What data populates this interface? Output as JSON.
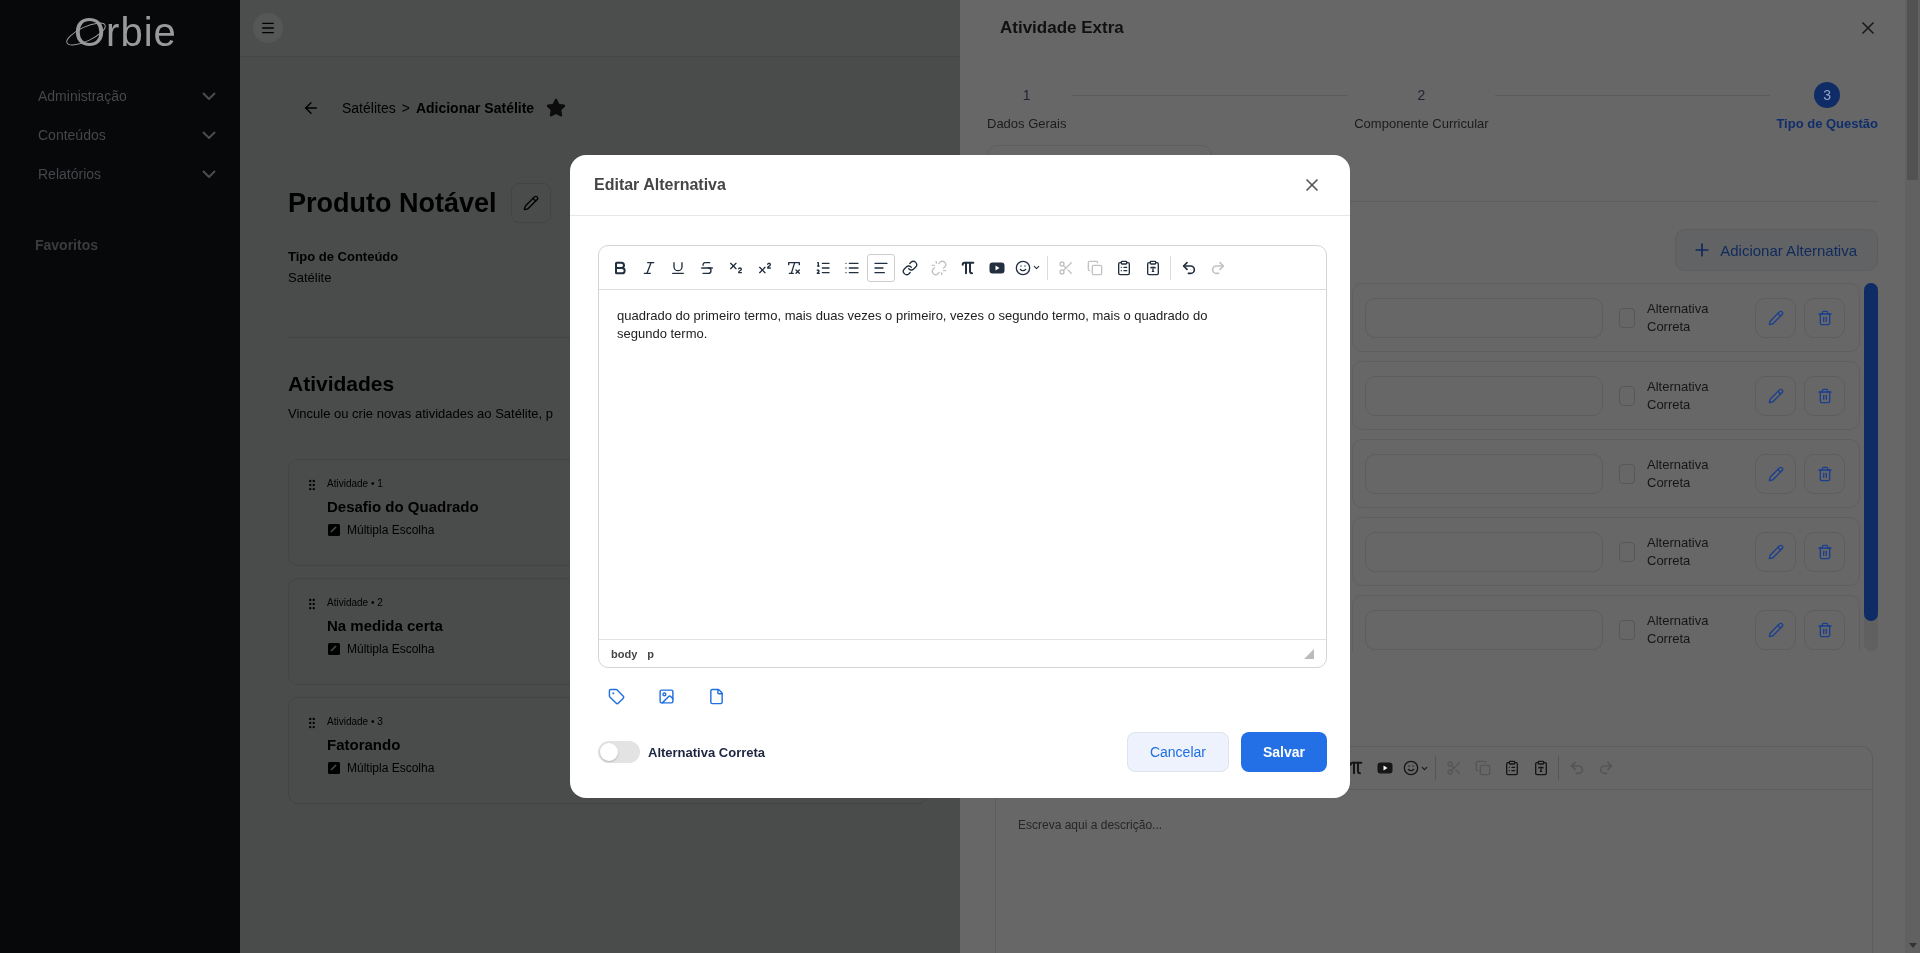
{
  "sidebar": {
    "logo": "Orbie",
    "items": [
      {
        "label": "Administração",
        "expanded": false
      },
      {
        "label": "Conteúdos",
        "expanded": false
      },
      {
        "label": "Relatórios",
        "expanded": false
      }
    ],
    "favorites_title": "Favoritos"
  },
  "main": {
    "breadcrumb": {
      "parent": "Satélites",
      "separator": ">",
      "current": "Adicionar Satélite",
      "favorite": true
    },
    "title": "Produto Notável",
    "content_type": {
      "label": "Tipo de Conteúdo",
      "value": "Satélite"
    },
    "activities": {
      "title": "Atividades",
      "subtitle": "Vincule ou crie novas atividades ao Satélite, p",
      "items": [
        {
          "label": "Atividade • 1",
          "title": "Desafio do Quadrado",
          "type": "Múltipla Escolha"
        },
        {
          "label": "Atividade • 2",
          "title": "Na medida certa",
          "type": "Múltipla Escolha"
        },
        {
          "label": "Atividade • 3",
          "title": "Fatorando",
          "type": "Múltipla Escolha"
        }
      ]
    }
  },
  "drawer": {
    "title": "Atividade Extra",
    "steps": [
      {
        "number": "1",
        "label": "Dados Gerais",
        "selected": false
      },
      {
        "number": "2",
        "label": "Componente Curricular",
        "selected": false
      },
      {
        "number": "3",
        "label": "Tipo de Questão",
        "selected": true
      }
    ],
    "add_button": "Adicionar Alternativa",
    "alternatives": [
      {
        "label": "Alternativa Correta",
        "checked": false
      },
      {
        "label": "Alternativa Correta",
        "checked": false
      },
      {
        "label": "Alternativa Correta",
        "checked": false
      },
      {
        "label": "Alternativa Correta",
        "checked": false
      },
      {
        "label": "Alternativa Correta",
        "checked": false
      }
    ],
    "description_editor": {
      "placeholder": "Escreva aqui a descrição...",
      "toolbar_groups": [
        [
          {
            "kind": "pi",
            "disabled": false,
            "selected": false
          },
          {
            "kind": "youtube",
            "disabled": false,
            "selected": false
          },
          {
            "kind": "emoji",
            "disabled": false,
            "selected": false
          }
        ],
        [
          {
            "kind": "cut",
            "disabled": true,
            "selected": false
          },
          {
            "kind": "copy",
            "disabled": true,
            "selected": false
          },
          {
            "kind": "paste",
            "disabled": false,
            "selected": false
          },
          {
            "kind": "paste_text",
            "disabled": false,
            "selected": false
          }
        ],
        [
          {
            "kind": "undo",
            "disabled": true,
            "selected": false
          },
          {
            "kind": "redo",
            "disabled": true,
            "selected": false
          }
        ]
      ]
    }
  },
  "modal": {
    "title": "Editar Alternativa",
    "toolbar_groups": [
      [
        {
          "kind": "bold",
          "disabled": false,
          "selected": false
        },
        {
          "kind": "italic",
          "disabled": false,
          "selected": false
        },
        {
          "kind": "underline",
          "disabled": false,
          "selected": false
        },
        {
          "kind": "strike",
          "disabled": false,
          "selected": false
        },
        {
          "kind": "subscript",
          "disabled": false,
          "selected": false
        },
        {
          "kind": "superscript",
          "disabled": false,
          "selected": false
        },
        {
          "kind": "clear_format",
          "disabled": false,
          "selected": false
        },
        {
          "kind": "ordered_list",
          "disabled": false,
          "selected": false
        },
        {
          "kind": "bullet_list",
          "disabled": false,
          "selected": false
        },
        {
          "kind": "align_left",
          "disabled": false,
          "selected": true
        },
        {
          "kind": "link",
          "disabled": false,
          "selected": false
        },
        {
          "kind": "unlink",
          "disabled": true,
          "selected": false
        },
        {
          "kind": "pi",
          "disabled": false,
          "selected": false
        },
        {
          "kind": "youtube",
          "disabled": false,
          "selected": false
        },
        {
          "kind": "emoji",
          "disabled": false,
          "selected": false
        }
      ],
      [
        {
          "kind": "cut",
          "disabled": true,
          "selected": false
        },
        {
          "kind": "copy",
          "disabled": true,
          "selected": false
        },
        {
          "kind": "paste",
          "disabled": false,
          "selected": false
        },
        {
          "kind": "paste_text",
          "disabled": false,
          "selected": false
        }
      ],
      [
        {
          "kind": "undo",
          "disabled": false,
          "selected": false
        },
        {
          "kind": "redo",
          "disabled": true,
          "selected": false
        }
      ]
    ],
    "content": "quadrado do primeiro termo, mais duas vezes o primeiro, vezes o segundo termo, mais o quadrado do segundo termo.",
    "path": [
      "body",
      "p"
    ],
    "correct_toggle": {
      "label": "Alternativa Correta",
      "on": false
    },
    "cancel_button": "Cancelar",
    "save_button": "Salvar"
  }
}
